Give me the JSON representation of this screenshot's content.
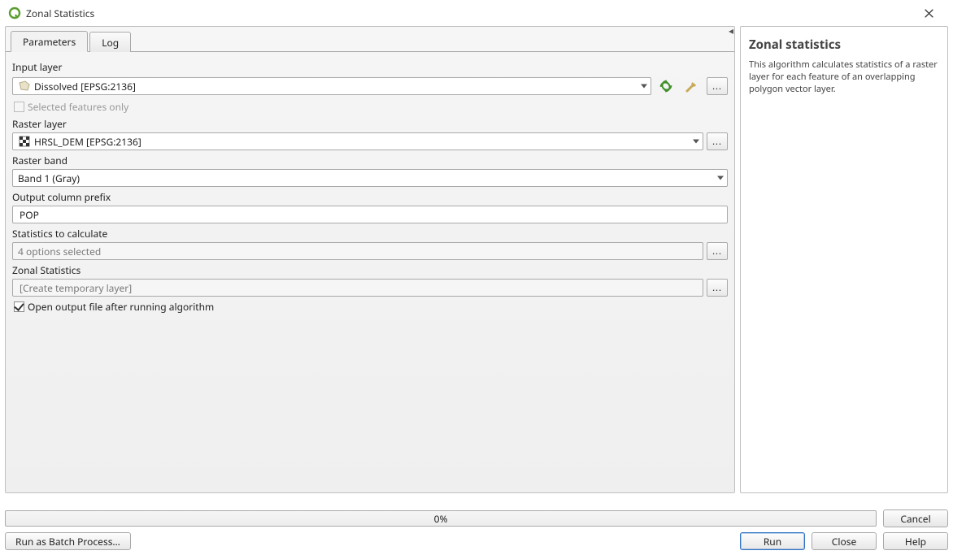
{
  "window": {
    "title": "Zonal Statistics"
  },
  "tabs": {
    "parameters": "Parameters",
    "log": "Log"
  },
  "params": {
    "input_layer_label": "Input layer",
    "input_layer_value": "Dissolved [EPSG:2136]",
    "selected_only_label": "Selected features only",
    "raster_layer_label": "Raster layer",
    "raster_layer_value": "HRSL_DEM [EPSG:2136]",
    "raster_band_label": "Raster band",
    "raster_band_value": "Band 1 (Gray)",
    "prefix_label": "Output column prefix",
    "prefix_value": "POP",
    "stats_label": "Statistics to calculate",
    "stats_value": "4 options selected",
    "output_label": "Zonal Statistics",
    "output_placeholder": "[Create temporary layer]",
    "open_after_label": "Open output file after running algorithm"
  },
  "help": {
    "title": "Zonal statistics",
    "body": "This algorithm calculates statistics of a raster layer for each feature of an overlapping polygon vector layer."
  },
  "footer": {
    "progress": "0%",
    "cancel": "Cancel",
    "batch": "Run as Batch Process…",
    "run": "Run",
    "close": "Close",
    "helpbtn": "Help"
  },
  "icons": {
    "iterate": "iterate-icon",
    "advanced": "wrench-icon",
    "browse": "..."
  }
}
